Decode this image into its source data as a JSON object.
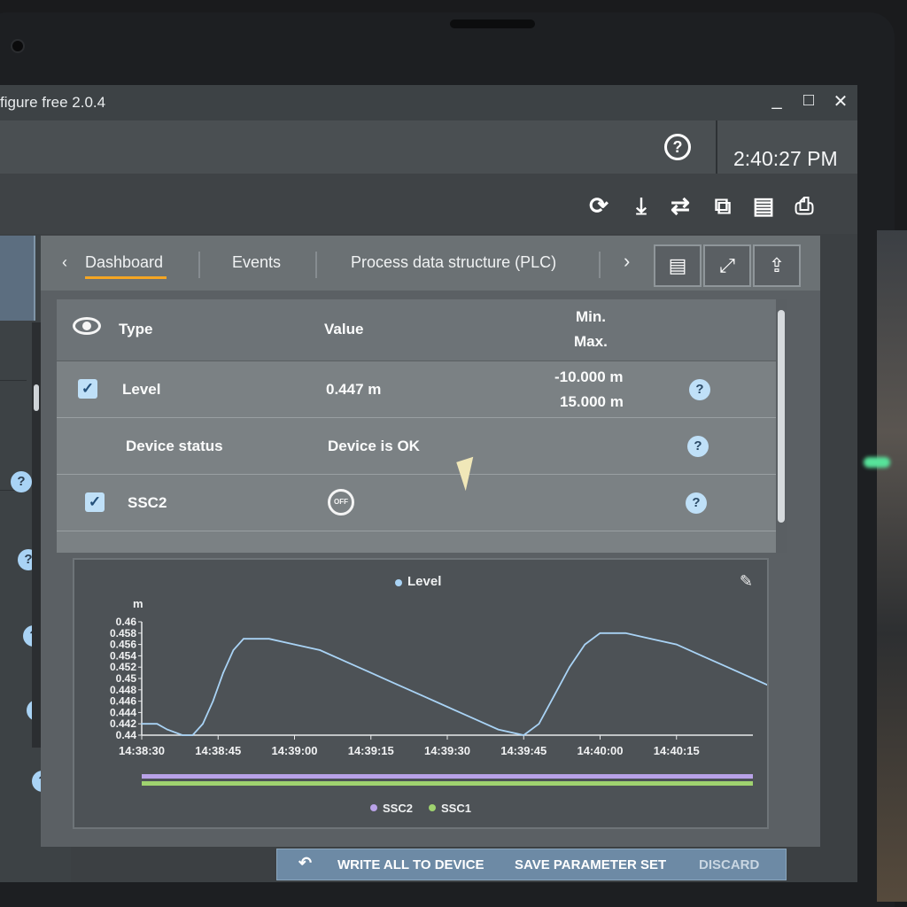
{
  "window": {
    "title": "figure free 2.0.4",
    "controls": {
      "minimize": "_",
      "maximize": "□",
      "close": "✕"
    }
  },
  "header": {
    "help_icon": "question-circle-icon",
    "clock": "2:40:27 PM"
  },
  "toolbar": {
    "icons": [
      "sync-icon",
      "download-icon",
      "swap-icon",
      "copy-document-icon",
      "print-preview-icon",
      "printer-icon"
    ]
  },
  "tabs": {
    "back_icon": "chevron-left-icon",
    "items": [
      "Dashboard",
      "Events",
      "Process data structure (PLC)"
    ],
    "active": "Dashboard",
    "next_icon": "chevron-right-icon",
    "buttons": [
      "table-view-icon",
      "fullscreen-icon",
      "export-icon"
    ]
  },
  "table": {
    "headers": {
      "type": "Type",
      "value": "Value",
      "min": "Min.",
      "max": "Max."
    },
    "rows": [
      {
        "checked": true,
        "type": "Level",
        "value": "0.447 m",
        "min": "-10.000 m",
        "max": "15.000 m"
      },
      {
        "checked": null,
        "type": "Device status",
        "value": "Device is OK",
        "min": "",
        "max": ""
      },
      {
        "checked": true,
        "type": "SSC2",
        "value": "OFF",
        "min": "",
        "max": ""
      }
    ]
  },
  "chart_data": {
    "type": "line",
    "title": "Level",
    "ylabel": "m",
    "ylim": [
      0.44,
      0.46
    ],
    "yticks": [
      "0.46",
      "0.458",
      "0.456",
      "0.454",
      "0.452",
      "0.45",
      "0.448",
      "0.446",
      "0.444",
      "0.442",
      "0.44"
    ],
    "xticks": [
      "14:38:30",
      "14:38:45",
      "14:39:00",
      "14:39:15",
      "14:39:30",
      "14:39:45",
      "14:40:00",
      "14:40:15"
    ],
    "series": [
      {
        "name": "Level",
        "color": "#a9d3f5",
        "points": [
          [
            "14:38:30",
            0.442
          ],
          [
            "14:38:33",
            0.442
          ],
          [
            "14:38:35",
            0.441
          ],
          [
            "14:38:38",
            0.44
          ],
          [
            "14:38:40",
            0.44
          ],
          [
            "14:38:42",
            0.442
          ],
          [
            "14:38:44",
            0.446
          ],
          [
            "14:38:46",
            0.451
          ],
          [
            "14:38:48",
            0.455
          ],
          [
            "14:38:50",
            0.457
          ],
          [
            "14:38:55",
            0.457
          ],
          [
            "14:39:00",
            0.456
          ],
          [
            "14:39:05",
            0.455
          ],
          [
            "14:39:10",
            0.453
          ],
          [
            "14:39:15",
            0.451
          ],
          [
            "14:39:20",
            0.449
          ],
          [
            "14:39:25",
            0.447
          ],
          [
            "14:39:30",
            0.445
          ],
          [
            "14:39:35",
            0.443
          ],
          [
            "14:39:40",
            0.441
          ],
          [
            "14:39:45",
            0.44
          ],
          [
            "14:39:48",
            0.442
          ],
          [
            "14:39:51",
            0.447
          ],
          [
            "14:39:54",
            0.452
          ],
          [
            "14:39:57",
            0.456
          ],
          [
            "14:40:00",
            0.458
          ],
          [
            "14:40:05",
            0.458
          ],
          [
            "14:40:10",
            0.457
          ],
          [
            "14:40:15",
            0.456
          ],
          [
            "14:40:20",
            0.454
          ],
          [
            "14:40:25",
            0.452
          ],
          [
            "14:40:30",
            0.45
          ],
          [
            "14:40:35",
            0.448
          ],
          [
            "14:40:40",
            0.447
          ]
        ]
      }
    ],
    "bottom_bars": [
      {
        "name": "SSC2",
        "color": "#b9a2e8"
      },
      {
        "name": "SSC1",
        "color": "#9fd26f"
      }
    ],
    "legend": [
      "SSC2",
      "SSC1"
    ],
    "legend_position": "bottom"
  },
  "actions": {
    "undo_icon": "undo-icon",
    "write_all": "WRITE ALL TO DEVICE",
    "save_set": "SAVE PARAMETER SET",
    "discard": "DISCARD"
  }
}
